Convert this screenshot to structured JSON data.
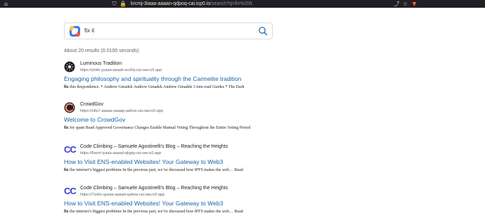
{
  "browser": {
    "url_host": "krcmj-3iaaa-aaaan-qdpoq-cai.icp0.io",
    "url_path": "/search?q=fix%20it"
  },
  "search": {
    "query": "fix it"
  },
  "stats": "About 20 results (0.0100 seconds)",
  "results": [
    {
      "site": "Luminous Tradition",
      "url": "https://ytrkk-yyaaa-aaaak-acx6q-cai.raw.ic0.app",
      "title": "Engaging philosophy and spirituality through the Carmelite tradition",
      "snippet_bold": "fix",
      "snippet_rest": " this despondence. * Andrew Gmadek Andrew Gmadek Andrew Gmadek 3 min read Guides * The Dark",
      "icon": "luminous-favicon"
    },
    {
      "site": "CrowdGov",
      "url": "https://o8u7-aaaaa-aaaap-aahva-cai.raw.ic0.app",
      "title": "Welcome to CrowdGov",
      "snippet_bold": "fix",
      "snippet_rest": " for spam Read Approved Governance Changes Enable Manual Voting Throughout the Entire Voting Period",
      "icon": "crowdgov-favicon"
    },
    {
      "site": "Code Climbing – Samuele Agostinelli's Blog – Reaching the Heights",
      "url": "https://6wori-iyaaa-aaaad-qbgiq-cai.raw.ic0.app",
      "title": "How to Visit ENS-enabled Websites! Your Gateway to Web3",
      "snippet_bold": "fix",
      "snippet_rest": " the internet’s biggest problems In the previous part, we’ve discussed how IPFS makes the web… Read",
      "icon": "cc"
    },
    {
      "site": "Code Climbing – Samuele Agostinelli's Blog – Reaching the Heights",
      "url": "https://7sx6x-qyaaa-aaaad-qa4oa-cai.raw.ic0.app",
      "title": "How to Visit ENS-enabled Websites! Your Gateway to Web3",
      "snippet_bold": "fix",
      "snippet_rest": " the internet’s biggest problems In the previous part, we’ve discussed how IPFS makes the web… Read",
      "icon": "cc"
    }
  ]
}
